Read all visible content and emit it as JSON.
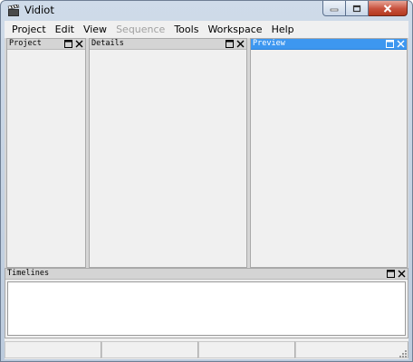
{
  "window": {
    "title": "Vidiot",
    "app_icon": "clapperboard-icon",
    "caption_buttons": [
      "minimize-icon",
      "maximize-icon",
      "close-icon"
    ]
  },
  "menu": {
    "items": [
      {
        "label": "Project",
        "enabled": true
      },
      {
        "label": "Edit",
        "enabled": true
      },
      {
        "label": "View",
        "enabled": true
      },
      {
        "label": "Sequence",
        "enabled": false
      },
      {
        "label": "Tools",
        "enabled": true
      },
      {
        "label": "Workspace",
        "enabled": true
      },
      {
        "label": "Help",
        "enabled": true
      }
    ]
  },
  "panes": {
    "project": {
      "title": "Project",
      "active": false
    },
    "details": {
      "title": "Details",
      "active": false
    },
    "preview": {
      "title": "Preview",
      "active": true
    },
    "timelines": {
      "title": "Timelines",
      "active": false
    }
  },
  "pane_buttons": {
    "float": "float-window-icon",
    "close": "close-icon"
  },
  "status": {
    "fields": [
      "",
      "",
      "",
      ""
    ]
  },
  "colors": {
    "active_caption": "#3d97f0",
    "inactive_caption": "#d4d4d4",
    "close_button": "#c7503c",
    "disabled_text": "#a0a0a0"
  }
}
